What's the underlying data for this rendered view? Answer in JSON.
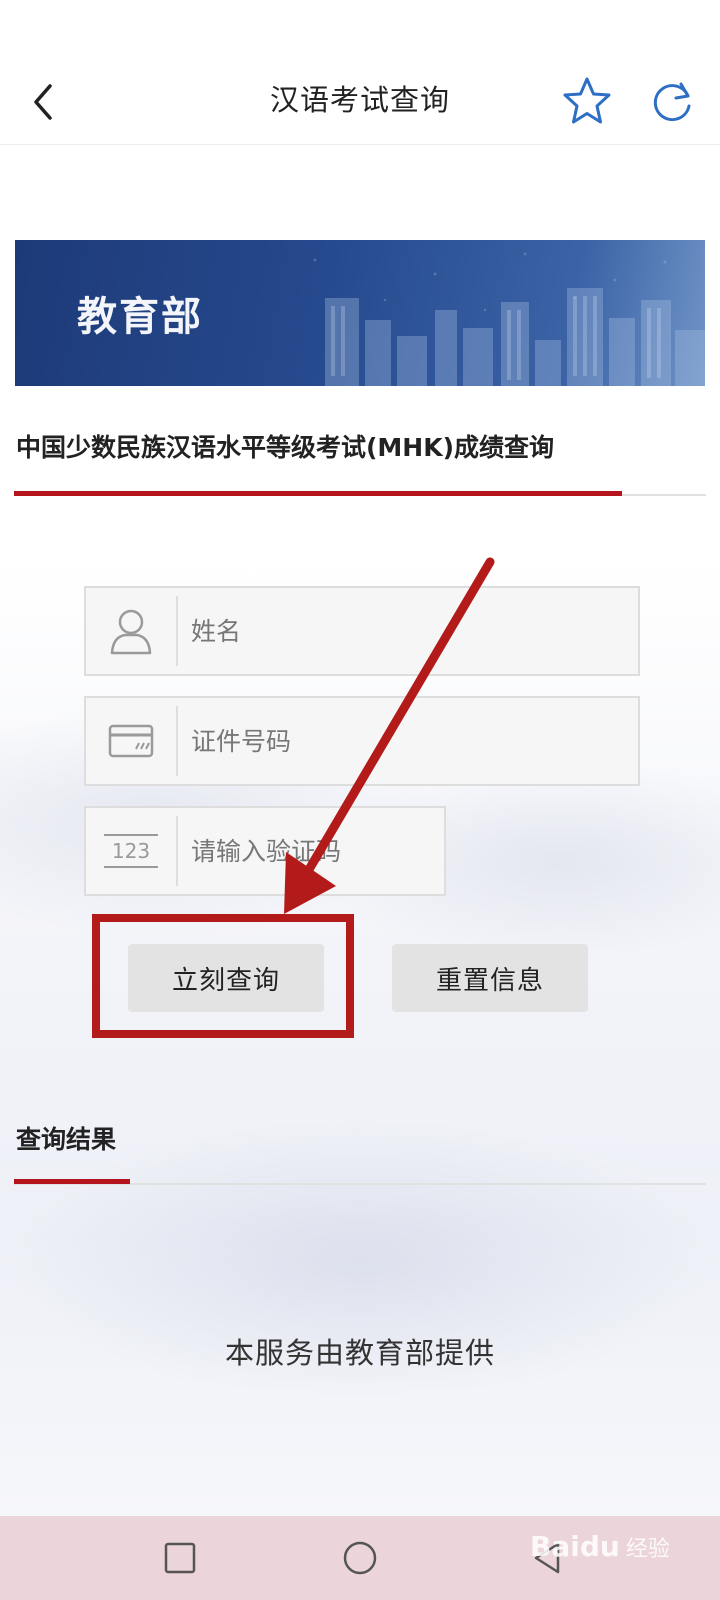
{
  "header": {
    "title": "汉语考试查询",
    "back_icon": "chevron-left-icon",
    "favorite_icon": "star-icon",
    "refresh_icon": "refresh-icon"
  },
  "banner": {
    "title": "教育部"
  },
  "query_section": {
    "title": "中国少数民族汉语水平等级考试(MHK)成绩查询"
  },
  "form": {
    "name_placeholder": "姓名",
    "id_placeholder": "证件号码",
    "captcha_placeholder": "请输入验证码",
    "submit_label": "立刻查询",
    "reset_label": "重置信息"
  },
  "result_section": {
    "title": "查询结果"
  },
  "footer": {
    "provider_text": "本服务由教育部提供"
  },
  "watermark": {
    "brand": "Baidu",
    "suffix": "经验"
  },
  "colors": {
    "accent_red": "#b5141c",
    "banner_blue": "#264a8e",
    "nav_bg": "#ecd5da"
  }
}
